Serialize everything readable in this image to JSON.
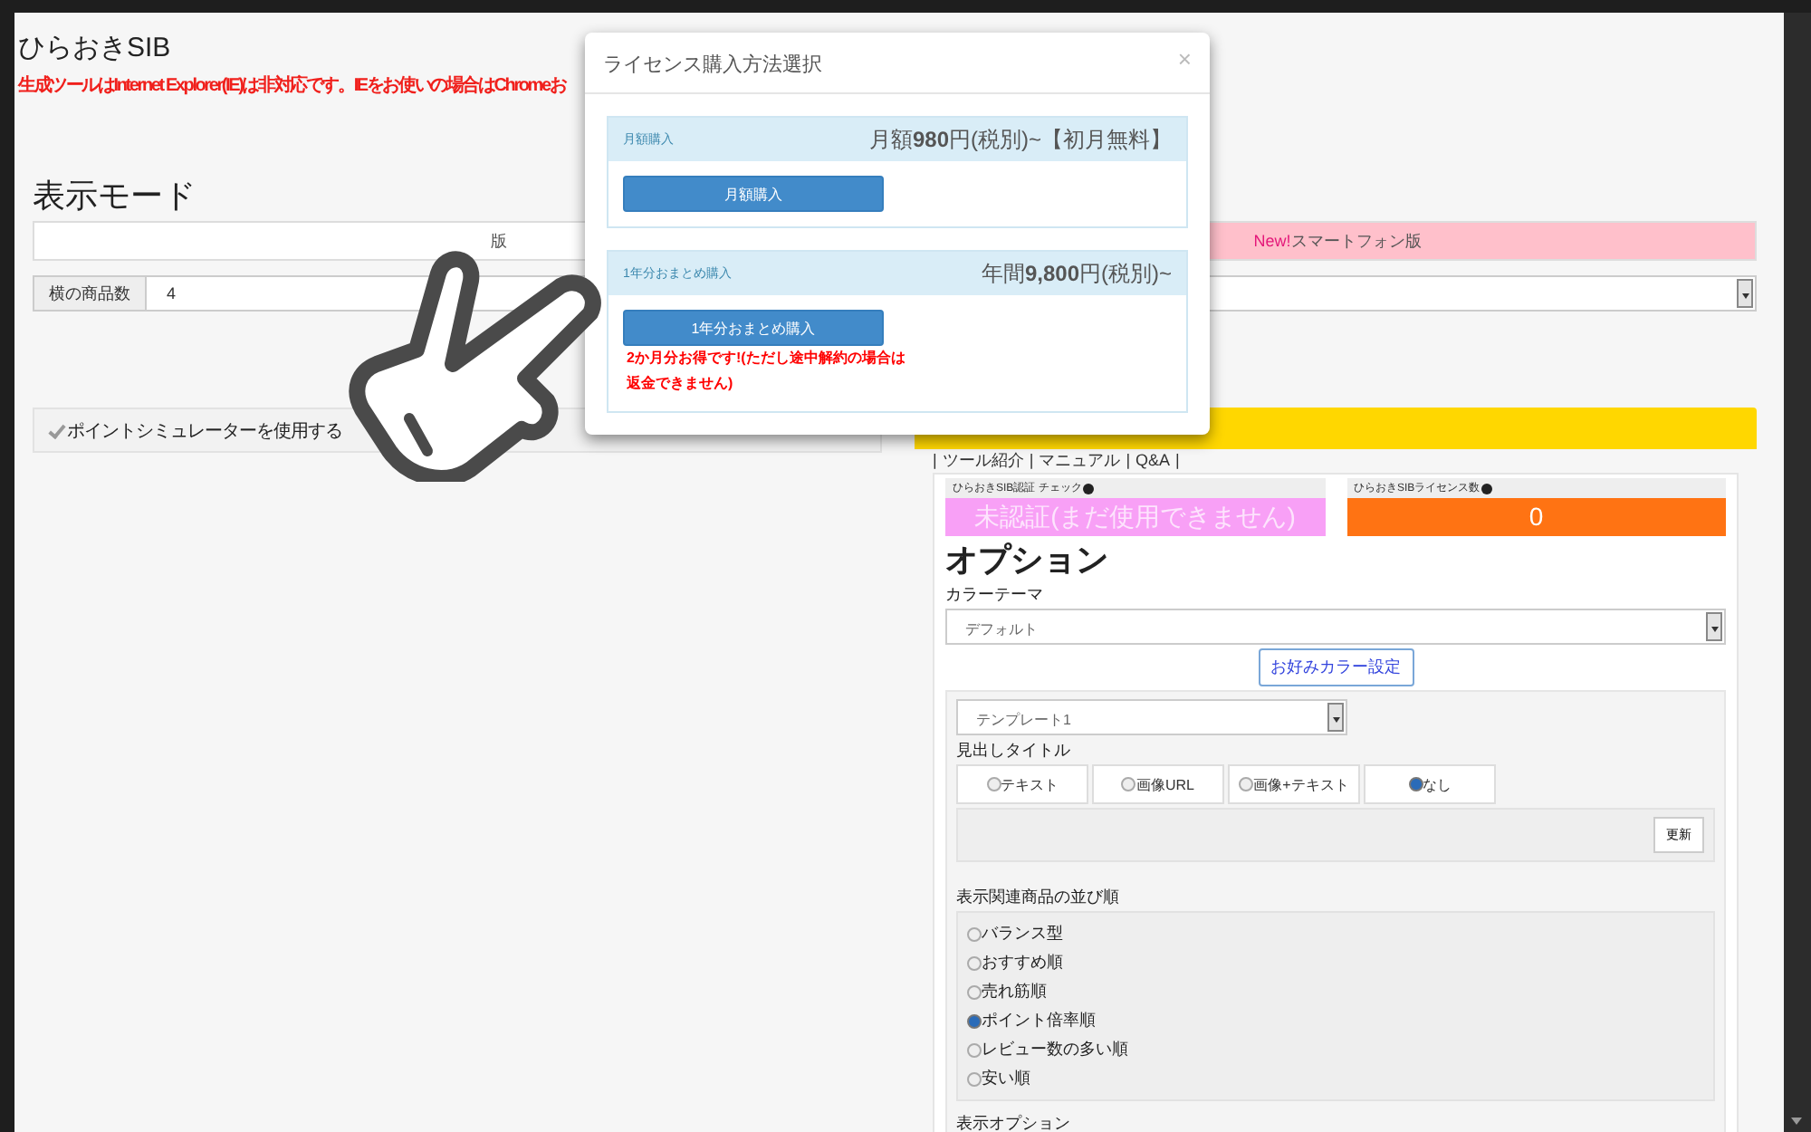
{
  "app": {
    "title": "ひらおきSIB",
    "notice": "生成ツールはInternet Explorer(IE)は非対応です。IEをお使いの場合はChromeお"
  },
  "display_mode": {
    "heading": "表示モード",
    "modes": [
      {
        "label": "版",
        "selected": false
      },
      {
        "badge": "New!",
        "label": "スマートフォン版",
        "selected": true
      }
    ]
  },
  "items_per_row": {
    "label": "横の商品数",
    "value": "4"
  },
  "point_simulator": {
    "label": "ポイントシミュレーターを使用する",
    "checked": true
  },
  "tool_panel": {
    "link_separator": "|",
    "links": [
      "ツール紹介",
      "マニュアル",
      "Q&A"
    ],
    "auth": {
      "label": "ひらおきSIB認証 チェック",
      "value": "未認証(まだ使用できません)"
    },
    "licenses": {
      "label": "ひらおきSIBライセンス数",
      "value": "0"
    }
  },
  "options": {
    "heading": "オプション",
    "color_theme": {
      "label": "カラーテーマ",
      "value": "デフォルト"
    },
    "custom_color_button": "お好みカラー設定",
    "template": {
      "value": "テンプレート1"
    },
    "heading_title": {
      "label": "見出しタイトル",
      "choices": [
        {
          "label": "テキスト",
          "selected": false
        },
        {
          "label": "画像URL",
          "selected": false
        },
        {
          "label": "画像+テキスト",
          "selected": false
        },
        {
          "label": "なし",
          "selected": true
        }
      ]
    },
    "update_button": "更新",
    "sort": {
      "label": "表示関連商品の並び順",
      "choices": [
        {
          "label": "バランス型",
          "selected": false
        },
        {
          "label": "おすすめ順",
          "selected": false
        },
        {
          "label": "売れ筋順",
          "selected": false
        },
        {
          "label": "ポイント倍率順",
          "selected": true
        },
        {
          "label": "レビュー数の多い順",
          "selected": false
        },
        {
          "label": "安い順",
          "selected": false
        }
      ]
    },
    "next_section": "表示オプション"
  },
  "modal": {
    "title": "ライセンス購入方法選択",
    "close": "×",
    "plans": [
      {
        "name": "月額購入",
        "price": "月額**980**円(税別)~【初月無料】",
        "button": "月額購入"
      },
      {
        "name": "1年分おまとめ購入",
        "price": "年間**9,800**円(税別)~",
        "button": "1年分おまとめ購入",
        "note": "2か月分お得です!(ただし途中解約の場合は返金できません)"
      }
    ]
  }
}
